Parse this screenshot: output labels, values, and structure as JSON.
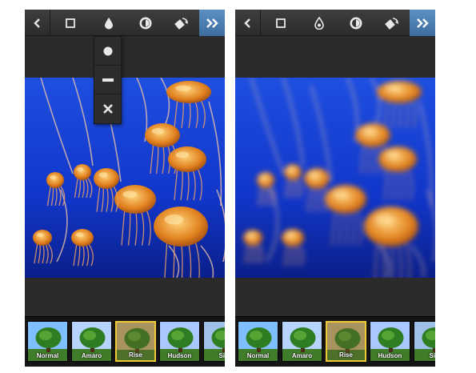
{
  "screens": [
    {
      "id": "left",
      "blur_menu_open": true,
      "photo_blur": 0,
      "filters": [
        {
          "name": "Normal",
          "tint": "#7ec0ff"
        },
        {
          "name": "Amaro",
          "tint": "#b7d4ff"
        },
        {
          "name": "Rise",
          "tint": "#c9b27a"
        },
        {
          "name": "Hudson",
          "tint": "#a8c8ff"
        },
        {
          "name": "Sie",
          "tint": "#9fc0e8"
        }
      ],
      "selected_filter": "Rise"
    },
    {
      "id": "right",
      "blur_menu_open": false,
      "photo_blur": 3.2,
      "filters": [
        {
          "name": "Normal",
          "tint": "#7ec0ff"
        },
        {
          "name": "Amaro",
          "tint": "#b7d4ff"
        },
        {
          "name": "Rise",
          "tint": "#c9b27a"
        },
        {
          "name": "Hudson",
          "tint": "#a8c8ff"
        },
        {
          "name": "Sie",
          "tint": "#9fc0e8"
        }
      ],
      "selected_filter": "Rise"
    }
  ],
  "toolbar_icons": [
    "back-chevron-icon",
    "frame-square-icon",
    "tilt-shift-drop-icon",
    "lux-sun-icon",
    "rotate-icon",
    "next-double-chevron-icon"
  ],
  "blur_menu_options": [
    "radial-blur-icon",
    "linear-blur-icon",
    "blur-off-icon"
  ],
  "colors": {
    "toolbar": "#333333",
    "next_button": "#4a7db3",
    "ocean": "#1136c9",
    "jellyfish": "#e0801e",
    "selected_border": "#f1c932"
  }
}
